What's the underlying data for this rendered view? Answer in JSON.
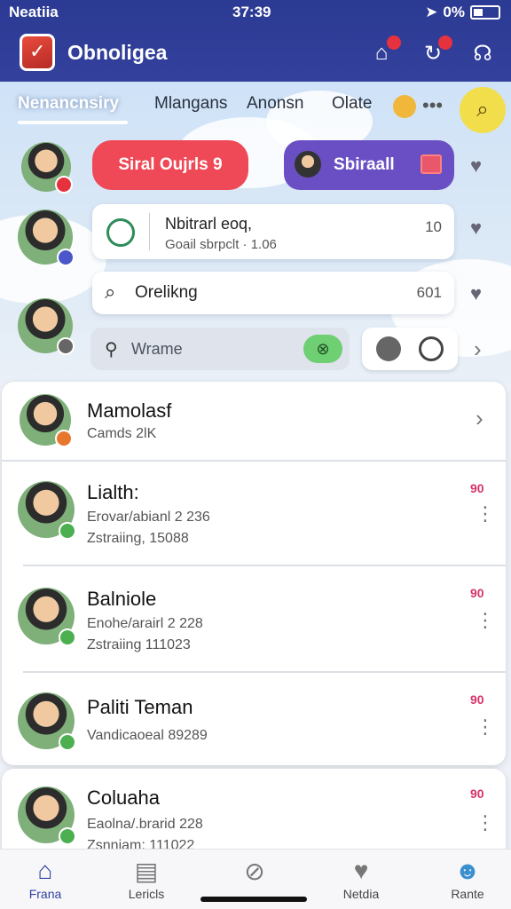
{
  "status": {
    "carrier": "Neatiia",
    "time": "37:39",
    "battery": "0%"
  },
  "header": {
    "title": "Obnoligea"
  },
  "tabs": [
    "Nenancnsiry",
    "Mlangans",
    "Anonsn",
    "Olate"
  ],
  "chips": {
    "red": "Siral  Oujrls 9",
    "purple": "Sbiraall"
  },
  "card1": {
    "line1": "Nbitrarl  eoq,",
    "line2": "Goail sbrpclt · 1.06",
    "count": "10"
  },
  "card2": {
    "label": "Orelikng",
    "count": "601"
  },
  "search": {
    "placeholder": "Wrame"
  },
  "list": [
    {
      "name": "Mamolasf",
      "sub1": "Camds 2lK",
      "sub2": "",
      "count": ""
    },
    {
      "name": "Lialth:",
      "sub1": "Erovar/abianl 2 236",
      "sub2": "Zstraiing, 15088",
      "count": "90"
    },
    {
      "name": "Balniole",
      "sub1": "Enohe/arairl 2 228",
      "sub2": "Zstraiing 111023",
      "count": "90"
    },
    {
      "name": "Paliti Teman",
      "sub1": "Vandicaoeal 89289",
      "sub2": "",
      "count": "90"
    },
    {
      "name": "Coluaha",
      "sub1": "Eaolna/.brarid 228",
      "sub2": "Zsnniam; 111022",
      "count": "90"
    }
  ],
  "nav": [
    "Frana",
    "Lericls",
    "",
    "Netdia",
    "Rante"
  ],
  "colors": {
    "header": "#2b3a93",
    "accent_red": "#ef4856",
    "accent_purple": "#6a4fc4",
    "badge": "#d6336c"
  }
}
